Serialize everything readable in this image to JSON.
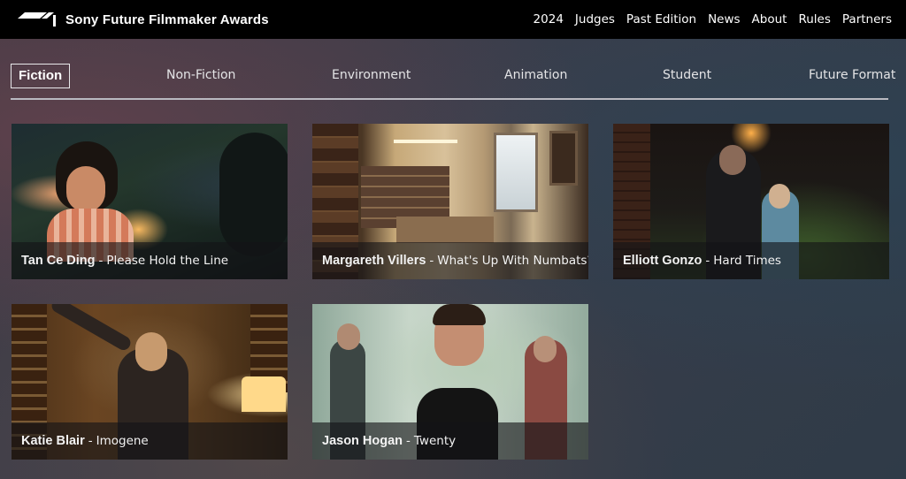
{
  "header": {
    "brand_name": "Sony Future Filmmaker Awards",
    "nav": [
      "2024",
      "Judges",
      "Past Edition",
      "News",
      "About",
      "Rules",
      "Partners"
    ]
  },
  "tabs": {
    "items": [
      "Fiction",
      "Non-Fiction",
      "Environment",
      "Animation",
      "Student",
      "Future Format"
    ],
    "active": "Fiction"
  },
  "films": [
    {
      "director": "Tan Ce Ding",
      "title": "Please Hold the Line"
    },
    {
      "director": "Margareth Villers",
      "title": "What's Up With Numbats?"
    },
    {
      "director": "Elliott Gonzo",
      "title": "Hard Times"
    },
    {
      "director": "Katie Blair",
      "title": "Imogene"
    },
    {
      "director": "Jason Hogan",
      "title": "Twenty"
    }
  ],
  "separator": "-",
  "colors": {
    "header_bg": "#000000",
    "tab_divider": "#b9b9c0",
    "caption_bg": "rgba(20,20,22,0.62)"
  }
}
